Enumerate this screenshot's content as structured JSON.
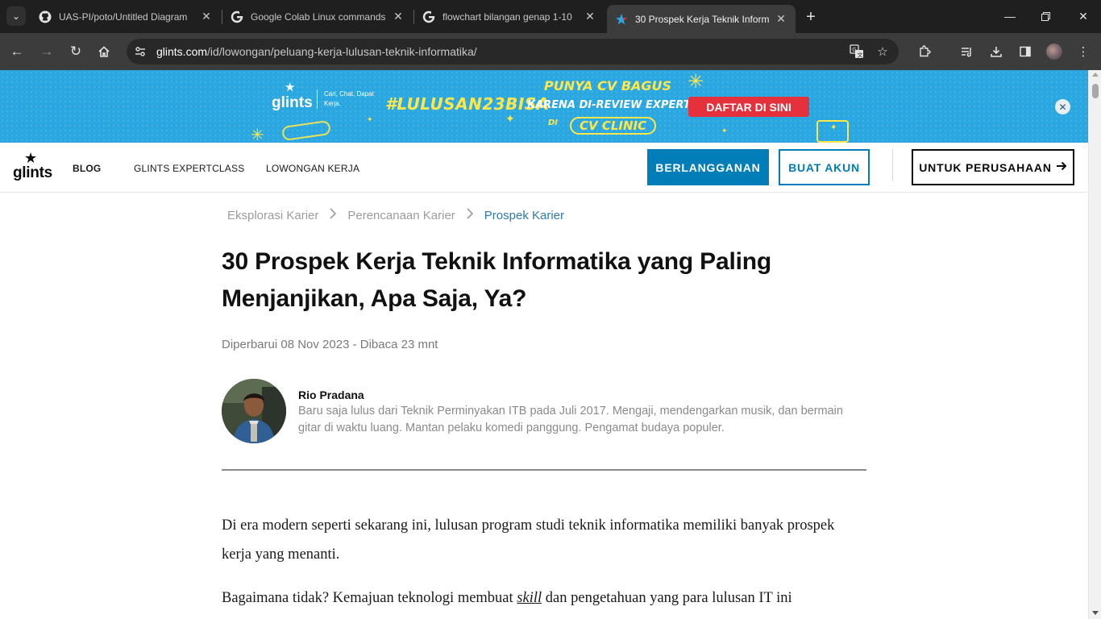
{
  "browser": {
    "tabs": [
      {
        "title": "UAS-PI/poto/Untitled Diagram",
        "icon": "github-icon",
        "active": false
      },
      {
        "title": "Google Colab Linux commands",
        "icon": "google-icon",
        "active": false
      },
      {
        "title": "flowchart bilangan genap 1-10",
        "icon": "google-icon",
        "active": false
      },
      {
        "title": "30 Prospek Kerja Teknik Informa",
        "icon": "glints-icon",
        "active": true
      }
    ],
    "url_host": "glints.com",
    "url_path": "/id/lowongan/peluang-kerja-lulusan-teknik-informatika/"
  },
  "banner": {
    "logo": "glints",
    "tagline": "Cari, Chat, Dapat Kerja.",
    "hashtag": "#LULUSAN23BISA",
    "line1": "PUNYA CV BAGUS",
    "line2": "KARENA DI-REVIEW EXPERT",
    "line3": "DI",
    "clinic": "CV CLINIC",
    "cta": "DAFTAR DI SINI",
    "colors": {
      "background": "#2aa7e0",
      "accent": "#ffe74a",
      "cta": "#e5313b"
    }
  },
  "header": {
    "logo": "glints",
    "nav": [
      "BLOG",
      "GLINTS EXPERTCLASS",
      "LOWONGAN KERJA"
    ],
    "subscribe": "BERLANGGANAN",
    "create_account": "BUAT AKUN",
    "for_company": "UNTUK PERUSAHAAN",
    "colors": {
      "primary": "#017eb7"
    }
  },
  "article": {
    "breadcrumb": [
      "Eksplorasi Karier",
      "Perencanaan Karier",
      "Prospek Karier"
    ],
    "title_line1": "30 Prospek Kerja Teknik Informatika yang Paling",
    "title_line2": "Menjanjikan, Apa Saja, Ya?",
    "meta": "Diperbarui 08 Nov 2023 - Dibaca 23 mnt",
    "author_name": "Rio Pradana",
    "author_bio": "Baru saja lulus dari Teknik Perminyakan ITB pada Juli 2017. Mengaji, mendengarkan musik, dan bermain gitar di waktu luang. Mantan pelaku komedi panggung. Pengamat budaya populer.",
    "p1": "Di era modern seperti sekarang ini, lulusan program studi teknik informatika memiliki banyak prospek kerja yang menanti.",
    "p2_before": "Bagaimana tidak? Kemajuan teknologi membuat ",
    "p2_em": "skill",
    "p2_after": " dan pengetahuan yang para lulusan IT ini"
  }
}
